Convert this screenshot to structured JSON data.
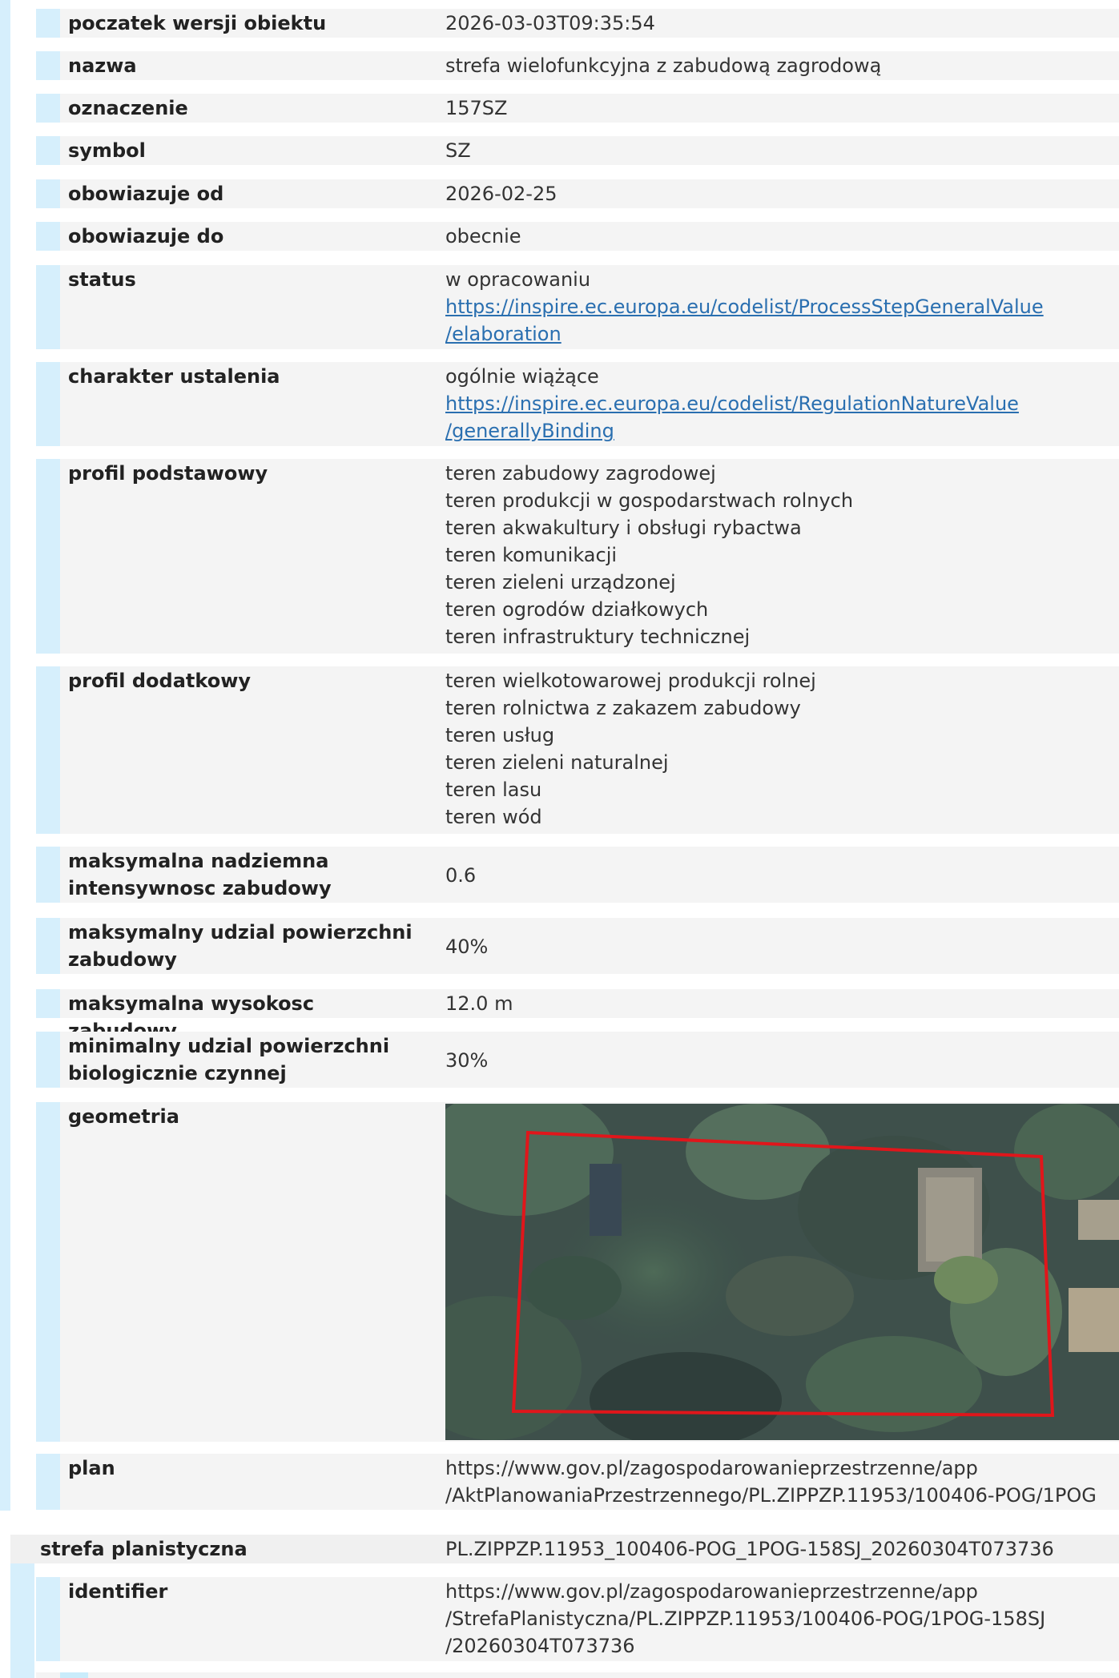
{
  "feature": {
    "rows": [
      {
        "label": "poczatek wersji obiektu",
        "lines": [
          "2026-03-03T09:35:54"
        ]
      },
      {
        "label": "nazwa",
        "lines": [
          "strefa wielofunkcyjna z zabudową zagrodową"
        ]
      },
      {
        "label": "oznaczenie",
        "lines": [
          "157SZ"
        ]
      },
      {
        "label": "symbol",
        "lines": [
          "SZ"
        ]
      },
      {
        "label": "obowiazuje od",
        "lines": [
          "2026-02-25"
        ]
      },
      {
        "label": "obowiazuje do",
        "lines": [
          "obecnie"
        ]
      },
      {
        "label": "status",
        "lines": [
          "w opracowaniu"
        ],
        "link": [
          "https://inspire.ec.europa.eu/codelist/ProcessStepGeneralValue",
          "/elaboration"
        ]
      },
      {
        "label": "charakter ustalenia",
        "lines": [
          "ogólnie wiążące"
        ],
        "link": [
          "https://inspire.ec.europa.eu/codelist/RegulationNatureValue",
          "/generallyBinding"
        ]
      },
      {
        "label": "profil podstawowy",
        "lines": [
          "teren zabudowy zagrodowej",
          "teren produkcji w gospodarstwach rolnych",
          "teren akwakultury i obsługi rybactwa",
          "teren komunikacji",
          "teren zieleni urządzonej",
          "teren ogrodów działkowych",
          "teren infrastruktury technicznej"
        ]
      },
      {
        "label": "profil dodatkowy",
        "lines": [
          "teren wielkotowarowej produkcji rolnej",
          "teren rolnictwa z zakazem zabudowy",
          "teren usług",
          "teren zieleni naturalnej",
          "teren lasu",
          "teren wód"
        ]
      },
      {
        "label": [
          "maksymalna nadziemna",
          "intensywnosc zabudowy"
        ],
        "lines": [
          "0.6"
        ]
      },
      {
        "label": [
          "maksymalny udzial powierzchni",
          "zabudowy"
        ],
        "lines": [
          "40%"
        ]
      },
      {
        "label": "maksymalna wysokosc zabudowy",
        "lines": [
          "12.0 m"
        ]
      },
      {
        "label": [
          "minimalny udzial powierzchni",
          "biologicznie czynnej"
        ],
        "lines": [
          "30%"
        ]
      },
      {
        "label": "geometria",
        "lines": []
      },
      {
        "label": "plan",
        "lines": [
          "https://www.gov.pl/zagospodarowanieprzestrzenne/app",
          "/AktPlanowaniaPrzestrzennego/PL.ZIPPZP.11953/100406-POG/1POG"
        ]
      }
    ]
  },
  "section": {
    "label": "strefa planistyczna",
    "value": "PL.ZIPPZP.11953_100406-POG_1POG-158SJ_20260304T073736",
    "rows": [
      {
        "label": "identifier",
        "lines": [
          "https://www.gov.pl/zagospodarowanieprzestrzenne/app",
          "/StrefaPlanistyczna/PL.ZIPPZP.11953/100406-POG/1POG-158SJ",
          "/20260304T073736"
        ]
      }
    ]
  },
  "geometry": {
    "outline_color": "#e0161b",
    "image": "aerial-photo"
  }
}
